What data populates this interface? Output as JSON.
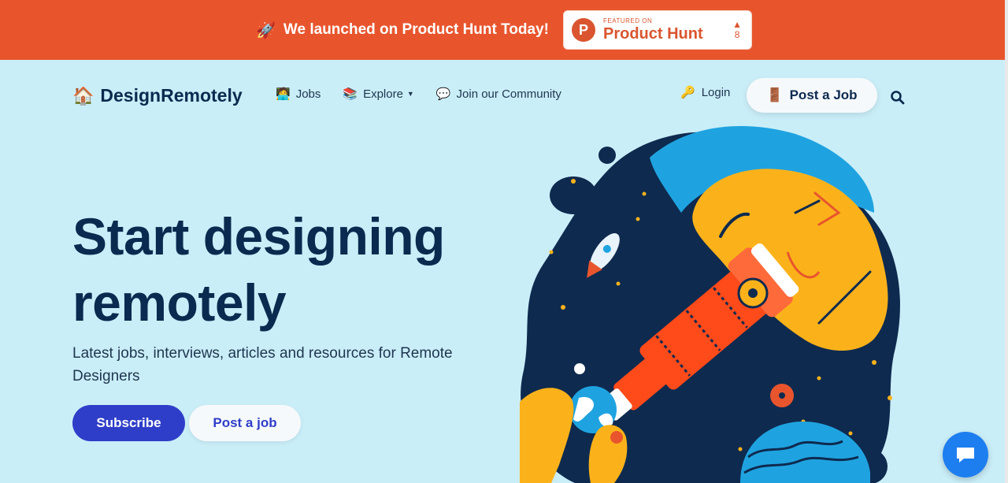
{
  "banner": {
    "text": "We launched on Product Hunt Today!",
    "rocket_icon": "rocket-icon",
    "badge": {
      "small": "FEATURED ON",
      "big": "Product Hunt",
      "votes": "8",
      "logo_letter": "P"
    }
  },
  "nav": {
    "brand": "DesignRemotely",
    "links": [
      {
        "label": "Jobs",
        "icon": "jobs-icon"
      },
      {
        "label": "Explore",
        "icon": "books-icon"
      },
      {
        "label": "Join our Community",
        "icon": "chat-bubble-icon"
      }
    ],
    "login": "Login",
    "post_job": "Post a Job"
  },
  "hero": {
    "title_line1": "Start designing",
    "title_line2": "remotely",
    "subtitle": "Latest jobs, interviews, articles and resources for Remote Designers",
    "subscribe": "Subscribe",
    "post_job": "Post a job"
  },
  "colors": {
    "banner": "#e8552d",
    "background": "#caeef8",
    "primary": "#2f3ec8",
    "text": "#0b2a4f",
    "chat": "#1d7ef0"
  }
}
